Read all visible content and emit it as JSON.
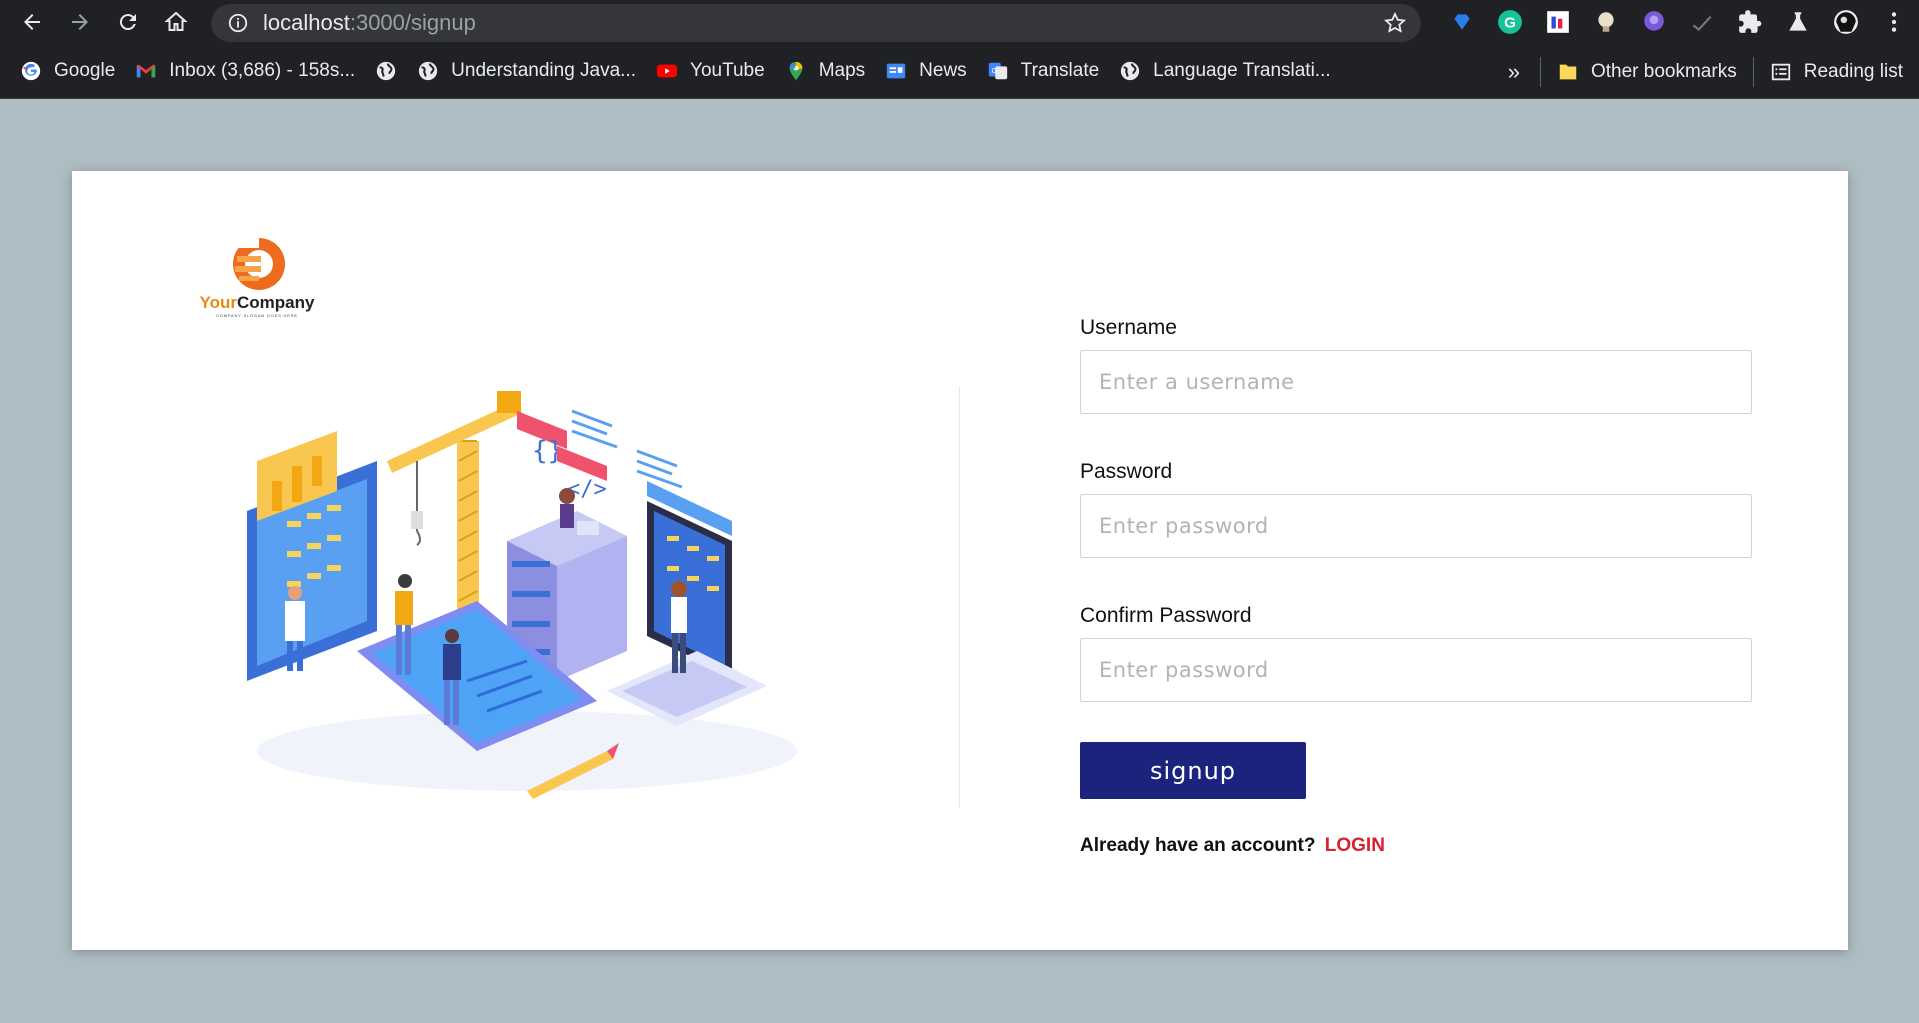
{
  "browser": {
    "url_host": "localhost",
    "url_path": ":3000/signup",
    "bookmarks": [
      {
        "label": "Google",
        "icon": "google-icon"
      },
      {
        "label": "Inbox (3,686) - 158s...",
        "icon": "gmail-icon"
      },
      {
        "label": "",
        "icon": "globe-icon"
      },
      {
        "label": "Understanding Java...",
        "icon": "globe-icon"
      },
      {
        "label": "YouTube",
        "icon": "youtube-icon"
      },
      {
        "label": "Maps",
        "icon": "maps-icon"
      },
      {
        "label": "News",
        "icon": "news-icon"
      },
      {
        "label": "Translate",
        "icon": "translate-icon"
      },
      {
        "label": "Language Translati...",
        "icon": "globe-icon"
      }
    ],
    "overflow": "»",
    "other_bookmarks": "Other bookmarks",
    "reading_list": "Reading list"
  },
  "brand": {
    "name_part1": "Your",
    "name_part2": "Company",
    "tagline": "COMPANY SLOGAN GOES HERE"
  },
  "form": {
    "username_label": "Username",
    "username_placeholder": "Enter a username",
    "password_label": "Password",
    "password_placeholder": "Enter password",
    "confirm_label": "Confirm Password",
    "confirm_placeholder": "Enter password",
    "submit": "signup",
    "already_text": "Already have an account?",
    "login_link": "LOGIN"
  },
  "colors": {
    "page_bg": "#aebcc4",
    "button": "#1b237c",
    "link": "#d8202f"
  }
}
